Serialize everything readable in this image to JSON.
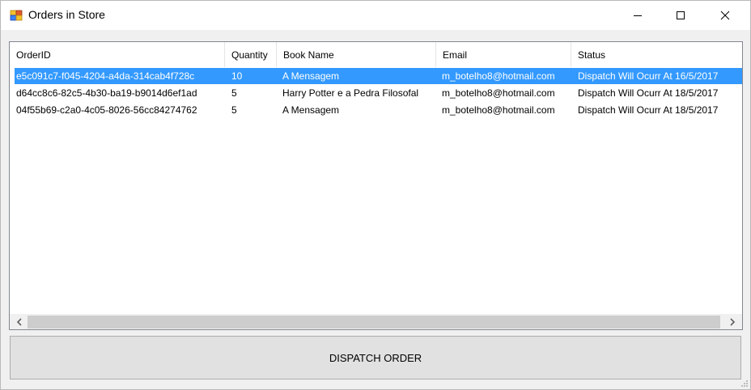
{
  "window": {
    "title": "Orders in Store"
  },
  "orders_list": {
    "columns": [
      "OrderID",
      "Quantity",
      "Book Name",
      "Email",
      "Status"
    ],
    "rows": [
      [
        "e5c091c7-f045-4204-a4da-314cab4f728c",
        "10",
        "A Mensagem",
        "m_botelho8@hotmail.com",
        "Dispatch Will Ocurr At 16/5/2017"
      ],
      [
        "d64cc8c6-82c5-4b30-ba19-b9014d6ef1ad",
        "5",
        "Harry Potter e a Pedra Filosofal",
        "m_botelho8@hotmail.com",
        "Dispatch Will Ocurr At 18/5/2017"
      ],
      [
        "04f55b69-c2a0-4c05-8026-56cc84274762",
        "5",
        "A Mensagem",
        "m_botelho8@hotmail.com",
        "Dispatch Will Ocurr At 18/5/2017"
      ]
    ]
  },
  "actions": {
    "dispatch_label": "DISPATCH ORDER"
  },
  "colors": {
    "selection": "#3399ff",
    "button_face": "#e1e1e1"
  }
}
